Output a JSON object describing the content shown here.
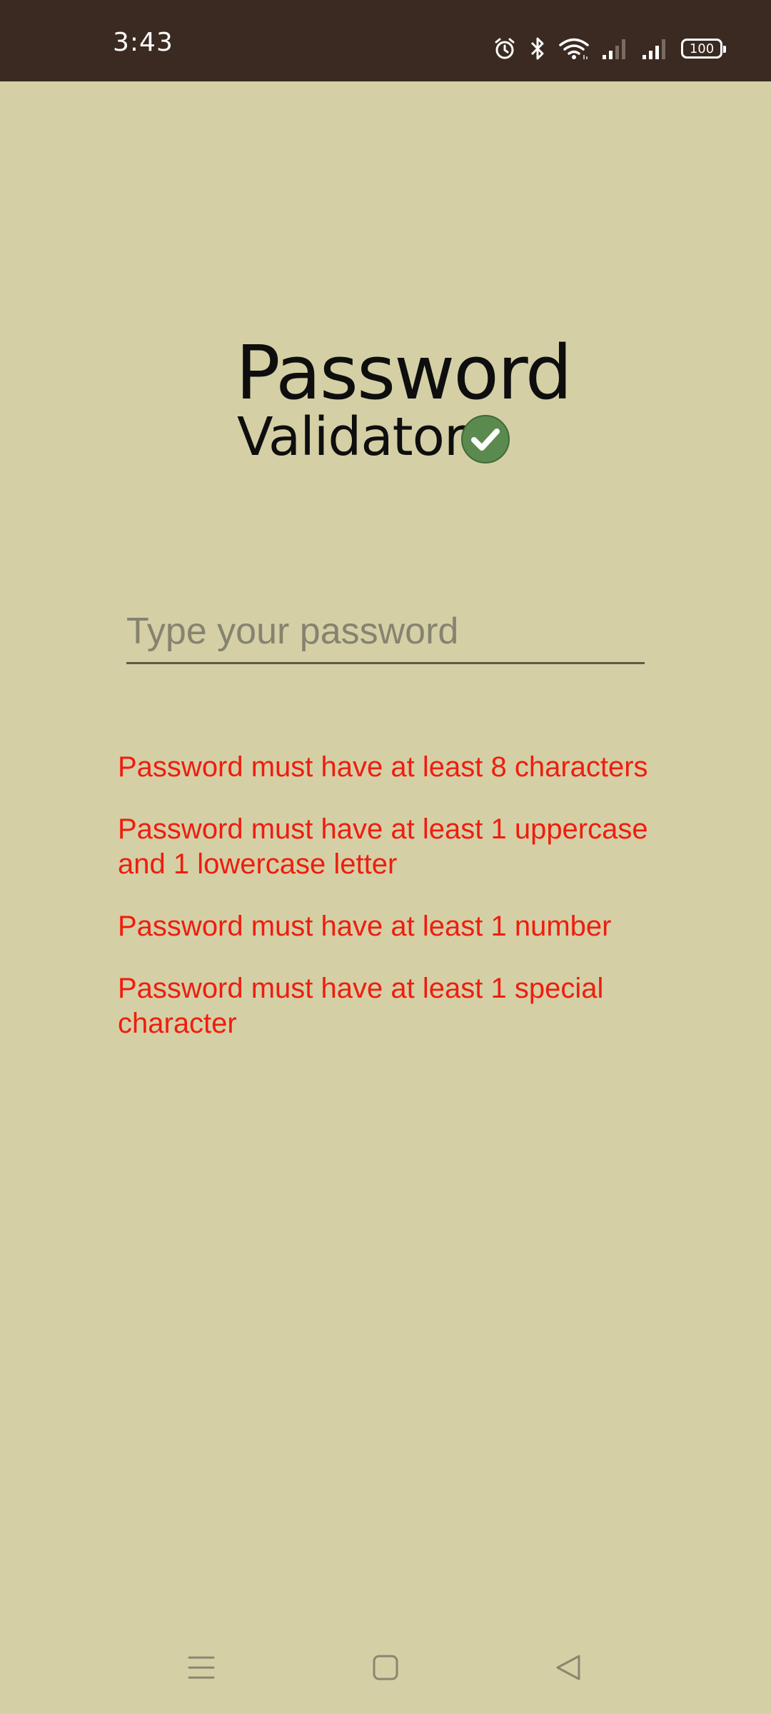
{
  "status_bar": {
    "time": "3:43",
    "battery": "100",
    "icons": [
      "alarm-icon",
      "bluetooth-icon",
      "wifi-icon",
      "signal-icon",
      "signal-icon",
      "battery-icon"
    ]
  },
  "header": {
    "title_line1": "Password",
    "title_line2": "Validator",
    "logo_icon": "check-circle-icon"
  },
  "password_input": {
    "placeholder": "Type your password",
    "value": ""
  },
  "rules": [
    "Password must have at least 8 characters",
    "Password must have at least 1 uppercase and 1 lowercase letter",
    "Password must have at least 1 number",
    "Password must have at least 1 special character"
  ],
  "nav_bar": {
    "icons": [
      "menu-icon",
      "home-square-icon",
      "back-triangle-icon"
    ]
  },
  "colors": {
    "background": "#d5cfa6",
    "status_bar": "#3b2a22",
    "rule_text": "#ef1d0d",
    "check_green": "#5b8a4f"
  }
}
